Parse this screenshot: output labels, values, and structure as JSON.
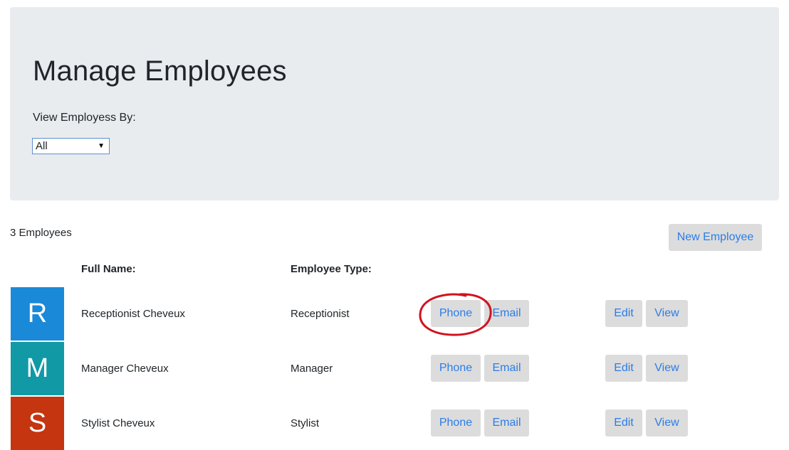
{
  "header": {
    "title": "Manage Employees",
    "filter_label": "View Employess By:",
    "filter_selected": "All"
  },
  "summary": {
    "count_text": "3 Employees",
    "new_button_label": "New Employee"
  },
  "table": {
    "headers": {
      "full_name": "Full Name:",
      "employee_type": "Employee Type:"
    },
    "rows": [
      {
        "initial": "R",
        "name": "Receptionist Cheveux",
        "type": "Receptionist",
        "avatar_color": "#1a8ad8",
        "phone_label": "Phone",
        "email_label": "Email",
        "edit_label": "Edit",
        "view_label": "View"
      },
      {
        "initial": "M",
        "name": "Manager Cheveux",
        "type": "Manager",
        "avatar_color": "#1199a6",
        "phone_label": "Phone",
        "email_label": "Email",
        "edit_label": "Edit",
        "view_label": "View"
      },
      {
        "initial": "S",
        "name": "Stylist Cheveux",
        "type": "Stylist",
        "avatar_color": "#c43510",
        "phone_label": "Phone",
        "email_label": "Email",
        "edit_label": "Edit",
        "view_label": "View"
      }
    ]
  },
  "colors": {
    "jumbotron_bg": "#e9ecef",
    "button_bg": "#dcdcdc",
    "button_text": "#2b7de9",
    "annotation": "#d0131e"
  }
}
